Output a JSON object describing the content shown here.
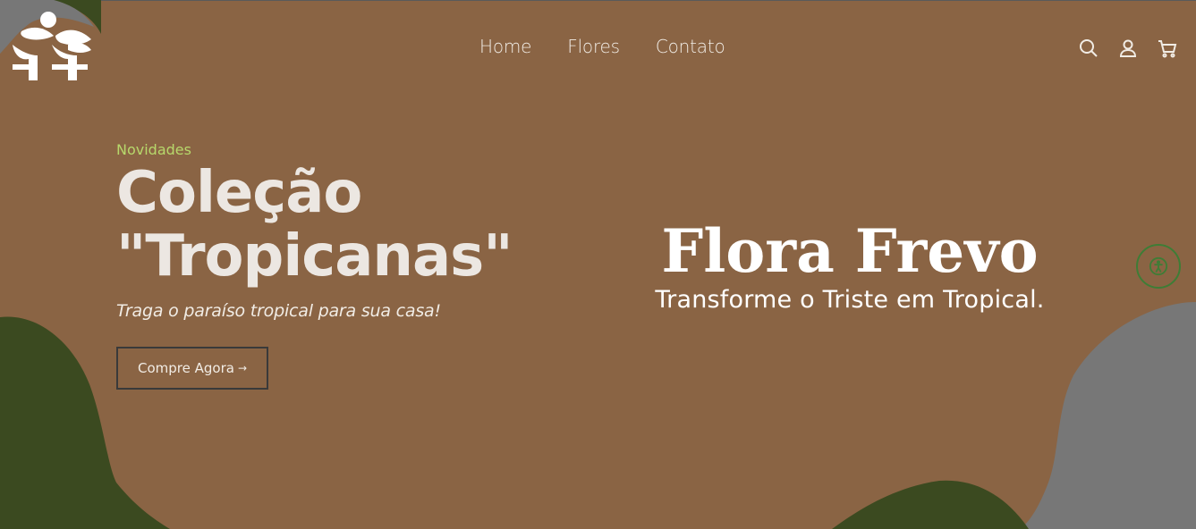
{
  "colors": {
    "background": "#8a6444",
    "dark_green": "#3b4a20",
    "gray": "#777777",
    "accent_green": "#b7d86b",
    "cta_border": "#3a3a3a",
    "a11y_ring": "#3e7d36"
  },
  "logo": {
    "icon": "flora-frevo-logo"
  },
  "nav": {
    "items": [
      "Home",
      "Flores",
      "Contato"
    ]
  },
  "header_icons": [
    "search-icon",
    "user-icon",
    "cart-icon"
  ],
  "hero": {
    "kicker": "Novidades",
    "title_line1": "Coleção",
    "title_line2": "\"Tropicanas\"",
    "subtitle": "Traga o paraíso tropical para sua casa!",
    "cta_label": "Compre Agora",
    "cta_arrow": "→"
  },
  "brand": {
    "name": "Flora Frevo",
    "tagline": "Transforme o Triste em Tropical."
  },
  "accessibility": {
    "icon": "accessibility-icon"
  }
}
